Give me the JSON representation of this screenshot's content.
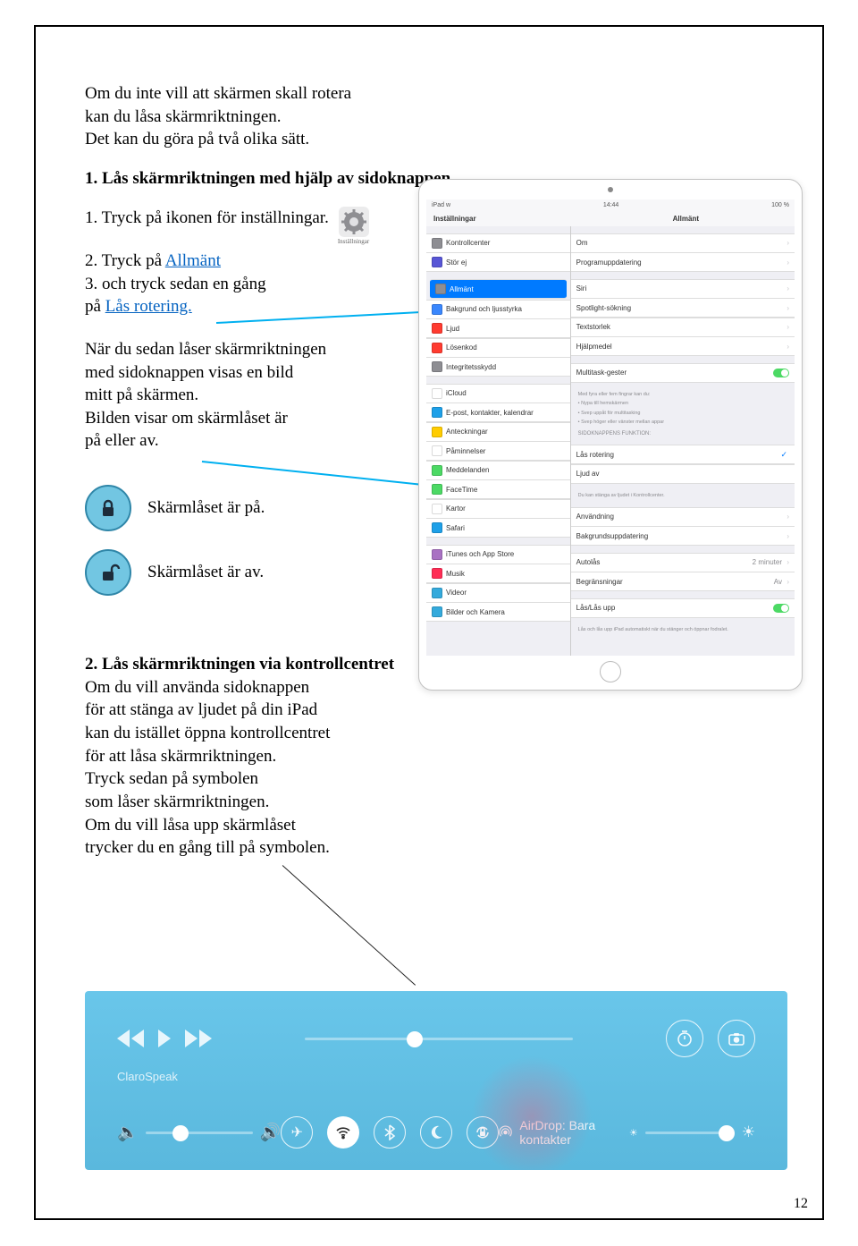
{
  "page_number": "12",
  "intro": {
    "line1": "Om du inte vill att skärmen skall rotera",
    "line2": "kan du låsa skärmriktningen.",
    "line3": "Det kan du göra på två olika sätt."
  },
  "section1": {
    "heading": "1. Lås skärmriktningen med hjälp av sidoknappen",
    "step1_a": "1. Tryck på ikonen för inställningar.",
    "step2_a": "2. Tryck på ",
    "step2_link": "Allmänt",
    "step3_a": "3. och tryck sedan en gång",
    "step3_b": "på ",
    "step3_link": "Lås rotering.",
    "note_a": "När du sedan låser skärmriktningen",
    "note_b": "med sidoknappen visas en bild",
    "note_c": "mitt på skärmen.",
    "note_d": "Bilden visar om skärmlåset är",
    "note_e": "på eller av.",
    "lock_on": "Skärmlåset är på.",
    "lock_off": "Skärmlåset är av."
  },
  "section2": {
    "heading": "2. Lås skärmriktningen via kontrollcentret",
    "p1": "Om du vill använda sidoknappen",
    "p2": "för att stänga av ljudet på din iPad",
    "p3": "kan du istället öppna kontrollcentret",
    "p4": "för att låsa skärmriktningen.",
    "p5": "Tryck sedan på symbolen",
    "p6": "som låser skärmriktningen.",
    "p7": "Om du vill låsa upp skärmlåset",
    "p8": "trycker du en gång till på symbolen."
  },
  "ipad": {
    "status_left": "iPad ᴡ",
    "status_time": "14:44",
    "status_batt": "100 %",
    "header_left": "Inställningar",
    "header_right": "Allmänt",
    "left_items": [
      {
        "label": "Kontrollcenter",
        "color": "#8e8e93"
      },
      {
        "label": "Stör ej",
        "color": "#5856d6"
      }
    ],
    "left_items_2": [
      {
        "label": "Allmänt",
        "color": "#8e8e93",
        "highlight": true
      },
      {
        "label": "Bakgrund och ljusstyrka",
        "color": "#3a87fd"
      },
      {
        "label": "Ljud",
        "color": "#ff3b30"
      },
      {
        "label": "Lösenkod",
        "color": "#ff3b30"
      },
      {
        "label": "Integritetsskydd",
        "color": "#8e8e93"
      }
    ],
    "left_items_3": [
      {
        "label": "iCloud",
        "color": "#ffffff"
      },
      {
        "label": "E-post, kontakter, kalendrar",
        "color": "#1ea0e8"
      },
      {
        "label": "Anteckningar",
        "color": "#ffcc00"
      },
      {
        "label": "Påminnelser",
        "color": "#ffffff"
      },
      {
        "label": "Meddelanden",
        "color": "#4cd964"
      },
      {
        "label": "FaceTime",
        "color": "#4cd964"
      },
      {
        "label": "Kartor",
        "color": "#ffffff"
      },
      {
        "label": "Safari",
        "color": "#1ea0e8"
      }
    ],
    "left_items_4": [
      {
        "label": "iTunes och App Store",
        "color": "#a971c3"
      },
      {
        "label": "Musik",
        "color": "#ff2d55"
      },
      {
        "label": "Videor",
        "color": "#34aadc"
      },
      {
        "label": "Bilder och Kamera",
        "color": "#34aadc"
      }
    ],
    "right_items_1": [
      {
        "label": "Om",
        "chev": true
      },
      {
        "label": "Programuppdatering",
        "chev": true
      }
    ],
    "right_items_2": [
      {
        "label": "Siri",
        "chev": true
      },
      {
        "label": "Spotlight-sökning",
        "chev": true
      },
      {
        "label": "Textstorlek",
        "chev": true
      },
      {
        "label": "Hjälpmedel",
        "chev": true
      }
    ],
    "right_header_multitask": "Multitask-gester",
    "right_note_multitask_1": "Med fyra eller fem fingrar kan du:",
    "right_note_multitask_2": "• Nypa till hemskärmen",
    "right_note_multitask_3": "• Svep uppåt för multitasking",
    "right_note_multitask_4": "• Svep höger eller vänster mellan appar",
    "right_header_sidoknapp": "SIDOKNAPPENS FUNKTION:",
    "right_items_3": [
      {
        "label": "Lås rotering",
        "check": true
      },
      {
        "label": "Ljud av"
      }
    ],
    "right_note_ljud": "Du kan stänga av ljudet i Kontrollcenter.",
    "right_items_4": [
      {
        "label": "Användning",
        "chev": true
      },
      {
        "label": "Bakgrundsuppdatering",
        "chev": true
      }
    ],
    "right_items_5": [
      {
        "label": "Autolås",
        "val": "2 minuter",
        "chev": true
      },
      {
        "label": "Begränsningar",
        "val": "Av",
        "chev": true
      }
    ],
    "right_items_6": [
      {
        "label": "Lås/Lås upp",
        "toggle": true
      }
    ],
    "right_note_las": "Lås och lås upp iPad automatiskt när du stänger och öppnar fodralet."
  },
  "control_center": {
    "app_label": "ClaroSpeak",
    "airdrop_label": "AirDrop: Bara kontakter"
  },
  "settings_chip_label": "Inställningar"
}
